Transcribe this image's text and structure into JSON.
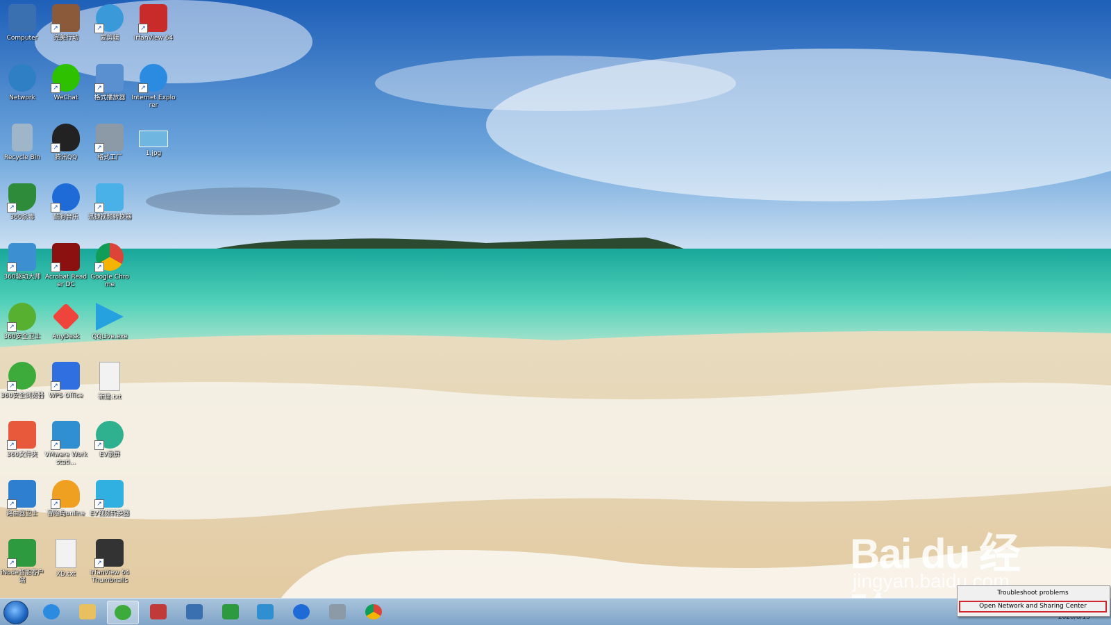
{
  "desktop": {
    "icons": [
      {
        "label": "Computer",
        "icon": "computer-icon",
        "color": "#3a6fb0"
      },
      {
        "label": "完美行动",
        "icon": "game-icon",
        "color": "#8a5a3a"
      },
      {
        "label": "爱剪辑",
        "icon": "video-editor-icon",
        "color": "#3a9ad9"
      },
      {
        "label": "IrfanView 64",
        "icon": "irfanview-icon",
        "color": "#c92a2a"
      },
      {
        "label": "Network",
        "icon": "network-icon",
        "color": "#2f7fc4"
      },
      {
        "label": "WeChat",
        "icon": "wechat-icon",
        "color": "#2dc100"
      },
      {
        "label": "格式播放器",
        "icon": "media-player-icon",
        "color": "#5a8fd0"
      },
      {
        "label": "Internet Explorer",
        "icon": "ie-icon",
        "color": "#2a8be0"
      },
      {
        "label": "Recycle Bin",
        "icon": "recycle-bin-icon",
        "color": "#9fb6c8"
      },
      {
        "label": "腾讯QQ",
        "icon": "qq-icon",
        "color": "#222222"
      },
      {
        "label": "格式工厂",
        "icon": "format-factory-icon",
        "color": "#8c9aa8"
      },
      {
        "label": "1.jpg",
        "icon": "image-file-icon",
        "color": "#6fb7e0"
      },
      {
        "label": "360杀毒",
        "icon": "360-antivirus-icon",
        "color": "#2e8b3a"
      },
      {
        "label": "酷狗音乐",
        "icon": "kugou-icon",
        "color": "#1e6ad6"
      },
      {
        "label": "迅捷视频转换器",
        "icon": "video-converter-icon",
        "color": "#4ab0e8"
      },
      {
        "label": "360驱动大师",
        "icon": "driver-icon",
        "color": "#3c8fd0"
      },
      {
        "label": "Acrobat Reader DC",
        "icon": "acrobat-icon",
        "color": "#8b1010"
      },
      {
        "label": "Google Chrome",
        "icon": "chrome-icon",
        "color": "#db4437"
      },
      {
        "label": "360安全卫士",
        "icon": "360-safe-icon",
        "color": "#58b030"
      },
      {
        "label": "AnyDesk",
        "icon": "anydesk-icon",
        "color": "#ef443b"
      },
      {
        "label": "QQLive.exe",
        "icon": "qqlive-icon",
        "color": "#26a1e0"
      },
      {
        "label": "360安全浏览器",
        "icon": "360-browser-icon",
        "color": "#3cab3c"
      },
      {
        "label": "WPS Office",
        "icon": "wps-icon",
        "color": "#2f6fe0"
      },
      {
        "label": "新建.txt",
        "icon": "text-file-icon",
        "color": "#f2f2f2"
      },
      {
        "label": "360文件夹",
        "icon": "360-folder-icon",
        "color": "#e8593b"
      },
      {
        "label": "VMware Workstati...",
        "icon": "vmware-icon",
        "color": "#2f8fd0"
      },
      {
        "label": "EV录屏",
        "icon": "ev-recorder-icon",
        "color": "#2fb08f"
      },
      {
        "label": "路由器卫士",
        "icon": "router-icon",
        "color": "#2f7fd0"
      },
      {
        "label": "冒险岛online",
        "icon": "maplestory-icon",
        "color": "#f0a020"
      },
      {
        "label": "EV视频转换器",
        "icon": "ev-converter-icon",
        "color": "#2fb0e0"
      },
      {
        "label": "iNode智能客户端",
        "icon": "inode-icon",
        "color": "#2e9a40"
      },
      {
        "label": "XD.txt",
        "icon": "text-file-icon",
        "color": "#f2f2f2"
      },
      {
        "label": "IrfanView 64 Thumbnails",
        "icon": "panda-icon",
        "color": "#333333"
      }
    ]
  },
  "taskbar": {
    "start": "start-orb-icon",
    "apps": [
      {
        "icon": "ie-icon",
        "color": "#2a8be0",
        "active": false
      },
      {
        "icon": "explorer-folder-icon",
        "color": "#e8c060",
        "active": false
      },
      {
        "icon": "360-browser-icon",
        "color": "#3cab3c",
        "active": true
      },
      {
        "icon": "snipping-tool-icon",
        "color": "#c03a3a",
        "active": false
      },
      {
        "icon": "network-computer-icon",
        "color": "#3a6fb0",
        "active": false
      },
      {
        "icon": "inode-icon",
        "color": "#2e9a40",
        "active": false
      },
      {
        "icon": "vmware-icon",
        "color": "#2f8fd0",
        "active": false
      },
      {
        "icon": "kugou-icon",
        "color": "#1e6ad6",
        "active": false
      },
      {
        "icon": "format-factory-icon",
        "color": "#8c9aa8",
        "active": false
      },
      {
        "icon": "chrome-icon",
        "color": "#db4437",
        "active": false
      }
    ],
    "clock_date": "2020/6/13"
  },
  "context_menu": {
    "items": [
      "Troubleshoot problems",
      "Open Network and Sharing Center"
    ],
    "highlight_color": "#d0262f"
  },
  "watermark": {
    "brand": "Bai du 经验",
    "url": "jingyan.baidu.com"
  }
}
